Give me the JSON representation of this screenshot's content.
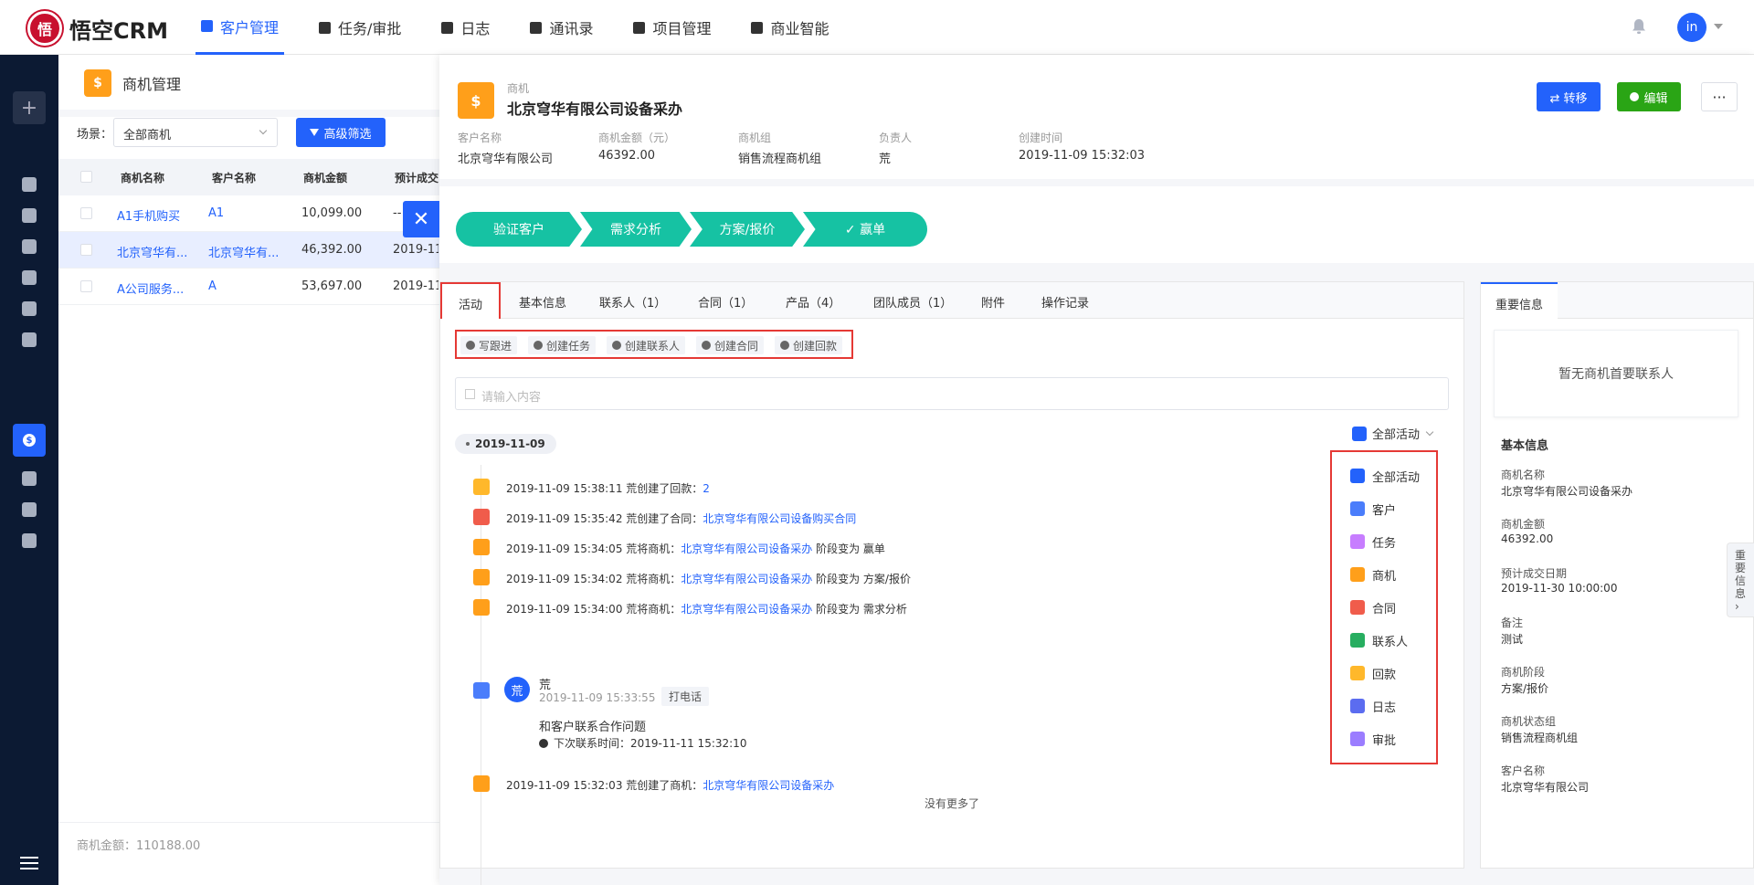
{
  "app": {
    "logo_text": "悟空CRM",
    "logo_glyph": "悟"
  },
  "topnav": {
    "items": [
      {
        "label": "客户管理",
        "icon": "building-icon"
      },
      {
        "label": "任务/审批",
        "icon": "briefcase-icon"
      },
      {
        "label": "日志",
        "icon": "doc-icon"
      },
      {
        "label": "通讯录",
        "icon": "phone-book-icon"
      },
      {
        "label": "项目管理",
        "icon": "list-icon"
      },
      {
        "label": "商业智能",
        "icon": "shield-icon"
      }
    ],
    "user_initials": "in"
  },
  "sidebar": {
    "plus": "+"
  },
  "list": {
    "title": "商机管理",
    "tag_glyph": "$",
    "scene_label": "场景：",
    "scene_value": "全部商机",
    "advanced_filter": "高级筛选",
    "columns": [
      "商机名称",
      "客户名称",
      "商机金额",
      "预计成交"
    ],
    "rows": [
      {
        "name": "A1手机购买",
        "customer": "A1",
        "amount": "10,099.00",
        "date": "--"
      },
      {
        "name": "北京穹华有...",
        "customer": "北京穹华有...",
        "amount": "46,392.00",
        "date": "2019-11-"
      },
      {
        "name": "A公司服务...",
        "customer": "A",
        "amount": "53,697.00",
        "date": "2019-11-"
      }
    ],
    "footer": "商机金额：110188.00"
  },
  "detail": {
    "type_label": "商机",
    "title": "北京穹华有限公司设备采办",
    "icon_glyph": "$",
    "transfer_button": "⇄ 转移",
    "edit_button": "编辑",
    "more_button": "···",
    "meta": [
      {
        "label": "客户名称",
        "value": "北京穹华有限公司"
      },
      {
        "label": "商机金额（元）",
        "value": "46392.00"
      },
      {
        "label": "商机组",
        "value": "销售流程商机组"
      },
      {
        "label": "负责人",
        "value": "荒"
      },
      {
        "label": "创建时间",
        "value": "2019-11-09 15:32:03"
      }
    ],
    "stages": [
      "验证客户",
      "需求分析",
      "方案/报价",
      "✓  赢单"
    ],
    "tabs": [
      "活动",
      "基本信息",
      "联系人（1）",
      "合同（1）",
      "产品（4）",
      "团队成员（1）",
      "附件",
      "操作记录"
    ],
    "actions": [
      "写跟进",
      "创建任务",
      "创建联系人",
      "创建合同",
      "创建回款"
    ],
    "input_placeholder": "请输入内容",
    "date_pill": "2019-11-09",
    "timeline": [
      {
        "prefix": "2019-11-09 15:38:11 荒创建了回款：",
        "link": "2",
        "suffix": "",
        "color": "#ffb82b"
      },
      {
        "prefix": "2019-11-09 15:35:42 荒创建了合同：",
        "link": "北京穹华有限公司设备购买合同",
        "suffix": "",
        "color": "#f05c4b"
      },
      {
        "prefix": "2019-11-09 15:34:05 荒将商机：",
        "link": "北京穹华有限公司设备采办",
        "suffix": " 阶段变为 赢单",
        "color": "#ff9f1a"
      },
      {
        "prefix": "2019-11-09 15:34:02 荒将商机：",
        "link": "北京穹华有限公司设备采办",
        "suffix": " 阶段变为 方案/报价",
        "color": "#ff9f1a"
      },
      {
        "prefix": "2019-11-09 15:34:00 荒将商机：",
        "link": "北京穹华有限公司设备采办",
        "suffix": " 阶段变为 需求分析",
        "color": "#ff9f1a"
      }
    ],
    "call": {
      "avatar": "荒",
      "name": "荒",
      "time": "2019-11-09 15:33:55",
      "tag": "打电话",
      "body": "和客户联系合作问题",
      "next": "下次联系时间：2019-11-11 15:32:10"
    },
    "created": {
      "prefix": "2019-11-09 15:32:03 荒创建了商机：",
      "link": "北京穹华有限公司设备采办"
    },
    "no_more": "没有更多了",
    "filter_label": "全部活动",
    "filter_options": [
      {
        "label": "全部活动",
        "color": "#2362fb"
      },
      {
        "label": "客户",
        "color": "#4a7dfb"
      },
      {
        "label": "任务",
        "color": "#c77dff"
      },
      {
        "label": "商机",
        "color": "#ff9f1a"
      },
      {
        "label": "合同",
        "color": "#f05c4b"
      },
      {
        "label": "联系人",
        "color": "#27ae60"
      },
      {
        "label": "回款",
        "color": "#ffb82b"
      },
      {
        "label": "日志",
        "color": "#5b6cf0"
      },
      {
        "label": "审批",
        "color": "#9b7dff"
      }
    ]
  },
  "side": {
    "tab": "重要信息",
    "empty_contact": "暂无商机首要联系人",
    "section": "基本信息",
    "fields": [
      {
        "label": "商机名称",
        "value": "北京穹华有限公司设备采办"
      },
      {
        "label": "商机金额",
        "value": "46392.00"
      },
      {
        "label": "预计成交日期",
        "value": "2019-11-30 10:00:00"
      },
      {
        "label": "备注",
        "value": "测试"
      },
      {
        "label": "商机阶段",
        "value": "方案/报价"
      },
      {
        "label": "商机状态组",
        "value": "销售流程商机组"
      },
      {
        "label": "客户名称",
        "value": "北京穹华有限公司"
      }
    ],
    "handle_text": "重要信息"
  },
  "colors": {
    "primary": "#2362fb",
    "stage": "#16c2a3",
    "edit": "#2aa515",
    "highlight_border": "#e53935"
  }
}
